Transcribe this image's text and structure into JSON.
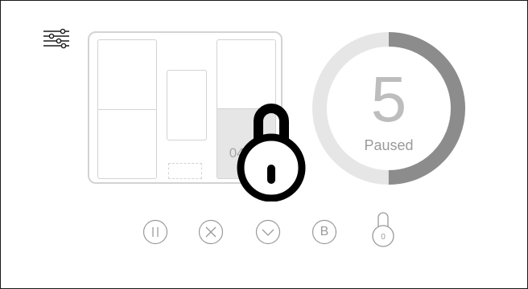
{
  "appliance": {
    "timer": "04:35"
  },
  "progress": {
    "value": "5",
    "status": "Paused",
    "fraction": 0.5
  },
  "controls": {
    "b_label": "B",
    "lock_count": "0"
  },
  "icons": {
    "settings": "sliders-icon",
    "pause": "pause-icon",
    "cancel": "cancel-icon",
    "down": "chevron-down-icon",
    "big_lock": "lock-icon",
    "small_lock": "lock-icon"
  },
  "colors": {
    "ring_track": "#e6e6e6",
    "ring_progress": "#8c8c8c",
    "lock": "#000000",
    "control": "#9a9a9a"
  }
}
